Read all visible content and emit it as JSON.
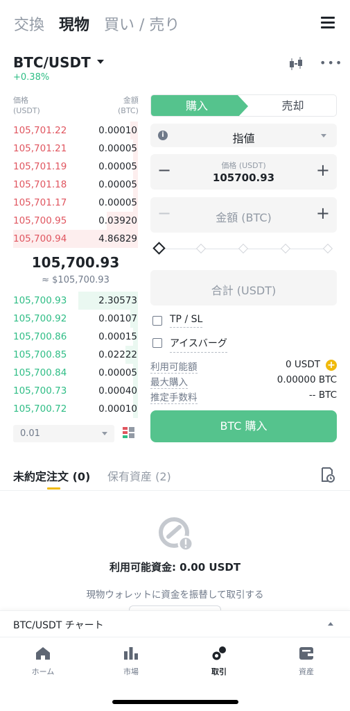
{
  "top_tabs": [
    "交換",
    "現物",
    "買い / 売り"
  ],
  "header": {
    "pair": "BTC/USDT",
    "change": "+0.38%"
  },
  "order_book": {
    "price_header": [
      "価格",
      "(USDT)"
    ],
    "amount_header": [
      "金額",
      "(BTC)"
    ],
    "asks": [
      {
        "price": "105,701.22",
        "qty": "0.00010",
        "depth": 0.06
      },
      {
        "price": "105,701.21",
        "qty": "0.00005",
        "depth": 0.04
      },
      {
        "price": "105,701.19",
        "qty": "0.00005",
        "depth": 0.04
      },
      {
        "price": "105,701.18",
        "qty": "0.00005",
        "depth": 0.04
      },
      {
        "price": "105,701.17",
        "qty": "0.00005",
        "depth": 0.04
      },
      {
        "price": "105,700.95",
        "qty": "0.03920",
        "depth": 0.25
      },
      {
        "price": "105,700.94",
        "qty": "4.86829",
        "depth": 1.0
      }
    ],
    "mid_price": "105,700.93",
    "mid_fiat": "≈ $105,700.93",
    "bids": [
      {
        "price": "105,700.93",
        "qty": "2.30573",
        "depth": 0.48
      },
      {
        "price": "105,700.92",
        "qty": "0.00107",
        "depth": 0.06
      },
      {
        "price": "105,700.86",
        "qty": "0.00015",
        "depth": 0.04
      },
      {
        "price": "105,700.85",
        "qty": "0.02222",
        "depth": 0.1
      },
      {
        "price": "105,700.84",
        "qty": "0.00005",
        "depth": 0.03
      },
      {
        "price": "105,700.73",
        "qty": "0.00040",
        "depth": 0.04
      },
      {
        "price": "105,700.72",
        "qty": "0.00010",
        "depth": 0.04
      }
    ],
    "precision": "0.01"
  },
  "trade_form": {
    "buy_label": "購入",
    "sell_label": "売却",
    "order_type": "指値",
    "price_caption": "価格 (USDT)",
    "price_value": "105700.93",
    "amount_placeholder": "金額 (BTC)",
    "total_placeholder": "合計 (USDT)",
    "slider_percent": 0,
    "tpsl_label": "TP / SL",
    "iceberg_label": "アイスバーグ",
    "available_label": "利用可能額",
    "available_value": "0 USDT",
    "max_buy_label": "最大購入",
    "max_buy_value": "0.00000 BTC",
    "fee_label": "推定手数料",
    "fee_value": "-- BTC",
    "submit_label": "BTC 購入"
  },
  "orders": {
    "tab_open": "未約定注文 (0)",
    "tab_holdings": "保有資産 (2)",
    "empty_title": "利用可能資金: 0.00 USDT",
    "empty_subtitle": "現物ウォレットに資金を振替して取引する"
  },
  "chart_bar": {
    "label": "BTC/USDT チャート"
  },
  "bottom_nav": [
    {
      "label": "ホーム",
      "icon": "home-icon"
    },
    {
      "label": "市場",
      "icon": "bar-chart-icon"
    },
    {
      "label": "取引",
      "icon": "trade-icon"
    },
    {
      "label": "資産",
      "icon": "wallet-icon"
    }
  ],
  "colors": {
    "buy": "#55c38d",
    "ask": "#e0555f",
    "bid": "#2ebd85",
    "accent": "#f0b90b"
  }
}
